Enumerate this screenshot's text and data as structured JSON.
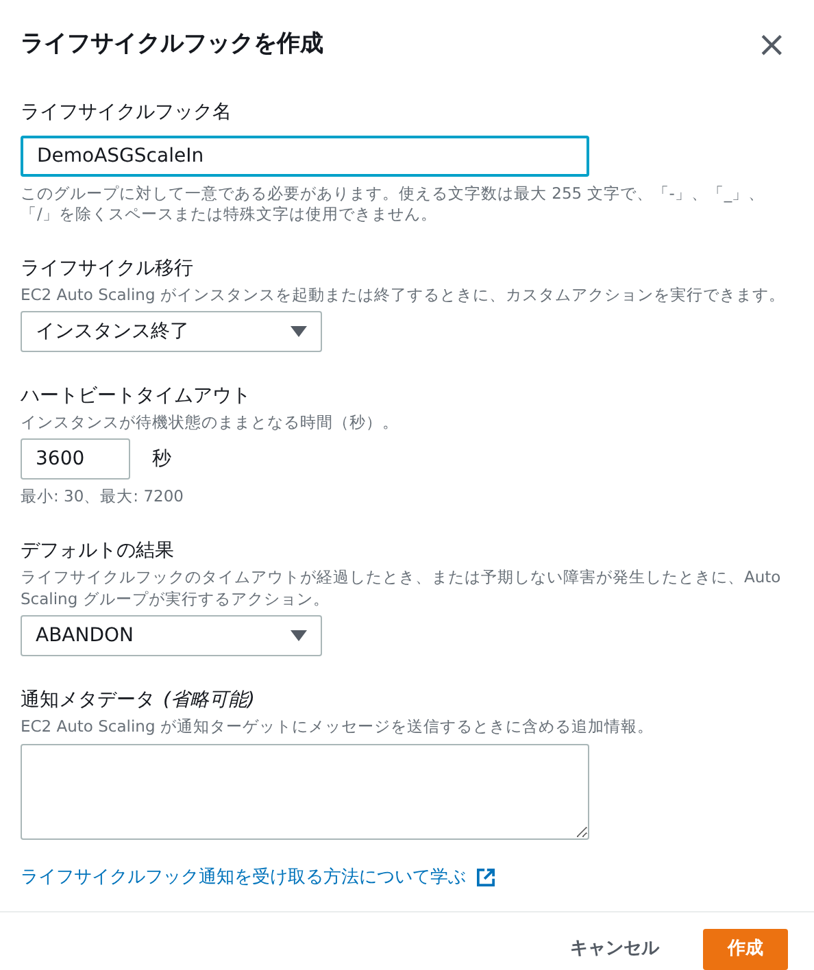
{
  "dialog": {
    "title": "ライフサイクルフックを作成",
    "close": "×"
  },
  "fields": [
    {
      "kind": "text",
      "label": "ライフサイクルフック名",
      "value": "DemoASGScaleIn",
      "focused": true,
      "hint": "このグループに対して一意である必要があります。使える文字数は最大 255 文字で、「-」、「_」、「/」を除くスペースまたは特殊文字は使用できません。"
    },
    {
      "kind": "select",
      "label": "ライフサイクル移行",
      "description": "EC2 Auto Scaling がインスタンスを起動または終了するときに、カスタムアクションを実行できます。",
      "value": "インスタンス終了"
    },
    {
      "kind": "number",
      "label": "ハートビートタイムアウト",
      "description": "インスタンスが待機状態のままとなる時間（秒）。",
      "value": "3600",
      "unit": "秒",
      "hint": "最小: 30、最大: 7200"
    },
    {
      "kind": "select",
      "label": "デフォルトの結果",
      "description": "ライフサイクルフックのタイムアウトが経過したとき、または予期しない障害が発生したときに、Auto Scaling グループが実行するアクション。",
      "value": "ABANDON"
    },
    {
      "kind": "textarea",
      "label": "通知メタデータ",
      "optional": "(省略可能)",
      "description": "EC2 Auto Scaling が通知ターゲットにメッセージを送信するときに含める追加情報。"
    }
  ],
  "learn_link": "ライフサイクルフック通知を受け取る方法について学ぶ",
  "buttons": [
    {
      "label": "キャンセル",
      "kind": "secondary"
    },
    {
      "label": "作成",
      "kind": "primary"
    }
  ]
}
